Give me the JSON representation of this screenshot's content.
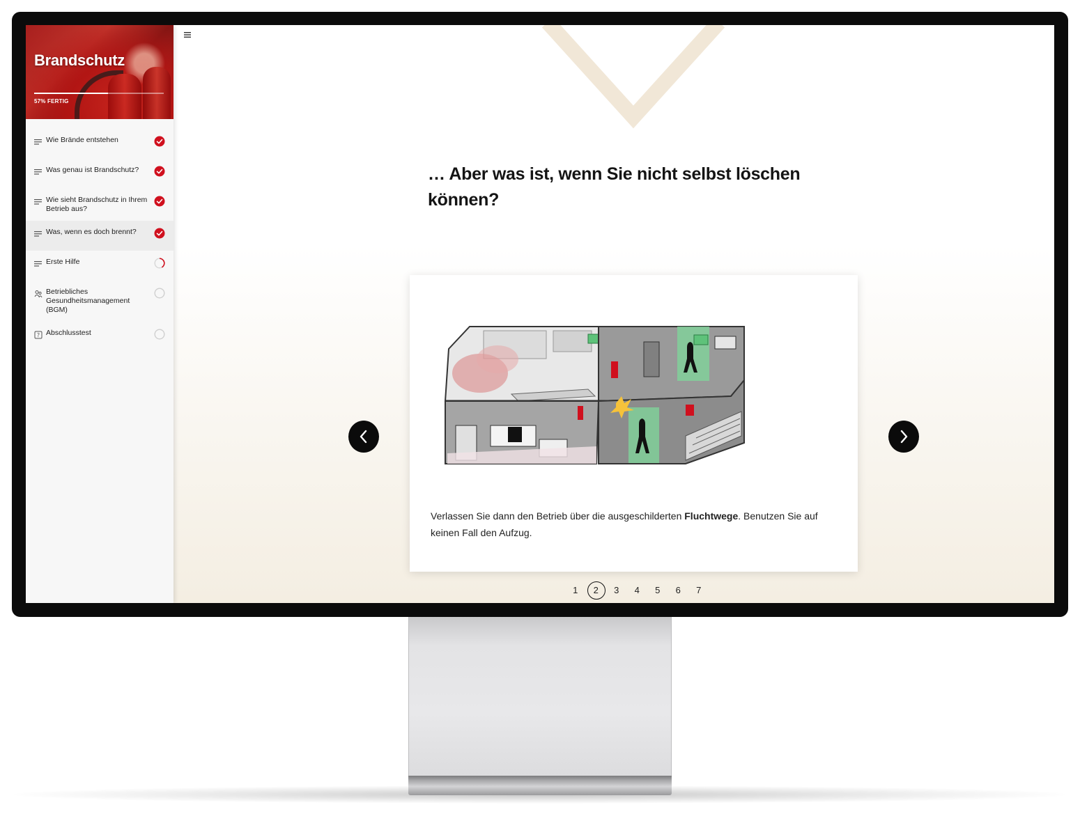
{
  "course": {
    "title": "Brandschutz",
    "progress_label": "57% FERTIG",
    "progress_percent": 57
  },
  "lessons": [
    {
      "label": "Wie Brände entstehen",
      "icon": "text-lines-icon",
      "status": "completed"
    },
    {
      "label": "Was genau ist Brandschutz?",
      "icon": "text-lines-icon",
      "status": "completed"
    },
    {
      "label": "Wie sieht Brandschutz in Ihrem Betrieb aus?",
      "icon": "text-lines-icon",
      "status": "completed"
    },
    {
      "label": "Was, wenn es doch brennt?",
      "icon": "text-lines-icon",
      "status": "completed",
      "active": true
    },
    {
      "label": "Erste Hilfe",
      "icon": "text-lines-icon",
      "status": "in-progress"
    },
    {
      "label": "Betriebliches Gesundheitsmanagement (BGM)",
      "icon": "people-icon",
      "status": "not-started"
    },
    {
      "label": "Abschlusstest",
      "icon": "quiz-icon",
      "status": "not-started"
    }
  ],
  "main": {
    "heading": "… Aber was ist, wenn Sie nicht selbst löschen können?",
    "slide": {
      "caption_before": "Verlassen Sie dann den Betrieb über die ausgeschilderten ",
      "caption_bold": "Fluchtwege",
      "caption_after": ". Benutzen Sie auf keinen Fall den Aufzug."
    },
    "pages": [
      "1",
      "2",
      "3",
      "4",
      "5",
      "6",
      "7"
    ],
    "current_page": "2"
  },
  "colors": {
    "accent_red": "#d0101e",
    "chevron": "#f0e6d6",
    "nav_button": "#0b0b0b",
    "green_exit": "#5ec27a"
  }
}
